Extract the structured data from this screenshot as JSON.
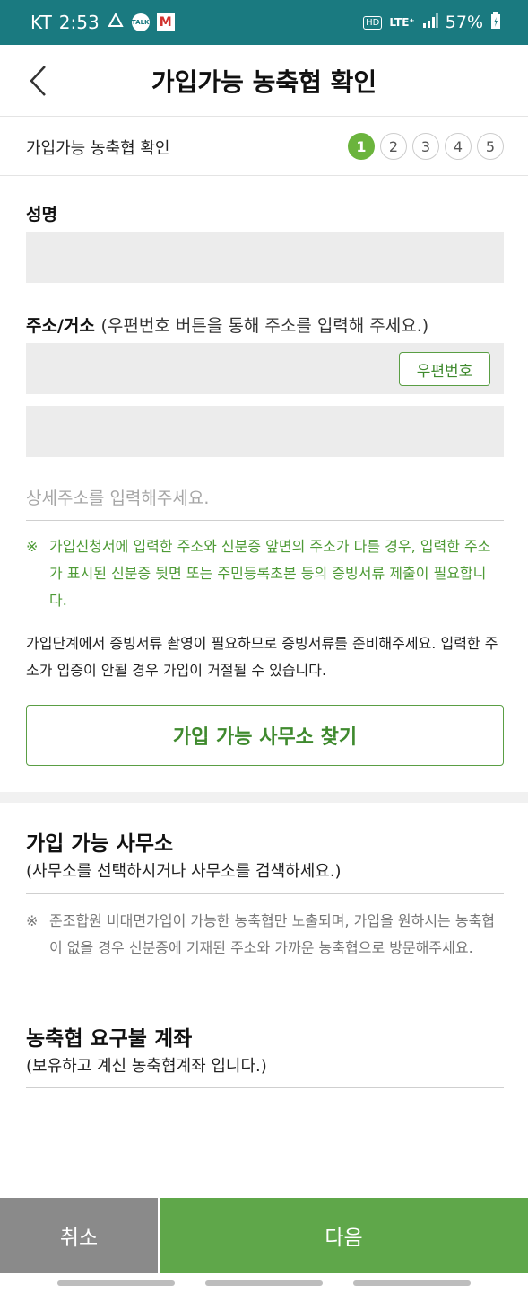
{
  "status_bar": {
    "carrier": "KT",
    "time": "2:53",
    "talk_icon_text": "TALK",
    "mail_icon_text": "M",
    "hd": "HD",
    "network": "LTE⁺",
    "battery": "57%"
  },
  "header": {
    "title": "가입가능 농축협 확인"
  },
  "steps": {
    "label": "가입가능 농축협 확인",
    "items": [
      "1",
      "2",
      "3",
      "4",
      "5"
    ]
  },
  "form": {
    "name_label": "성명",
    "address_label": "주소/거소",
    "address_hint": "(우편번호 버튼을 통해 주소를 입력해 주세요.)",
    "zip_button": "우편번호",
    "detail_placeholder": "상세주소를 입력해주세요.",
    "note_mark": "※",
    "note_green": "가입신청서에 입력한 주소와 신분증 앞면의 주소가 다를 경우, 입력한 주소가 표시된 신분증 뒷면 또는 주민등록초본 등의 증빙서류 제출이 필요합니다.",
    "info_text": "가입단계에서 증빙서류 촬영이 필요하므로 증빙서류를 준비해주세요. 입력한 주소가 입증이 안될 경우 가입이 거절될 수 있습니다.",
    "find_office_button": "가입 가능 사무소 찾기"
  },
  "office_section": {
    "title": "가입 가능 사무소",
    "subtitle": "(사무소를 선택하시거나 사무소를 검색하세요.)",
    "note_mark": "※",
    "note": "준조합원 비대면가입이 가능한 농축협만 노출되며, 가입을 원하시는 농축협이 없을 경우 신분증에 기재된 주소와 가까운 농축협으로 방문해주세요."
  },
  "account_section": {
    "title": "농축협 요구불 계좌",
    "subtitle": "(보유하고 계신 농축협계좌 입니다.)"
  },
  "bottom": {
    "cancel": "취소",
    "next": "다음"
  },
  "colors": {
    "status_bar": "#1a7a80",
    "accent_green": "#5fa74a",
    "step_active": "#6bb43d",
    "cancel_gray": "#8a8a8a"
  }
}
